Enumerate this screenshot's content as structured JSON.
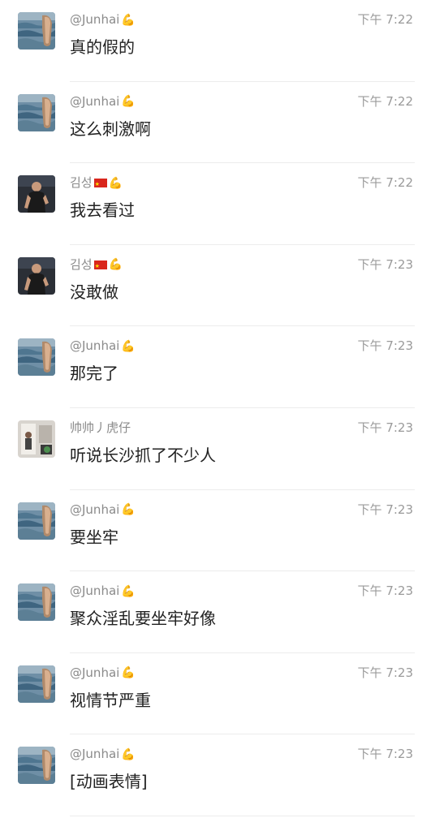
{
  "messages": [
    {
      "sender": "@Junhai",
      "badge": "💪",
      "flag": false,
      "avatar": "sea-avatar",
      "time": "下午 7:22",
      "text": "真的假的"
    },
    {
      "sender": "@Junhai",
      "badge": "💪",
      "flag": false,
      "avatar": "sea-avatar",
      "time": "下午 7:22",
      "text": "这么刺激啊"
    },
    {
      "sender": "김성",
      "badge": "💪",
      "flag": true,
      "avatar": "man-avatar",
      "time": "下午 7:22",
      "text": "我去看过"
    },
    {
      "sender": "김성",
      "badge": "💪",
      "flag": true,
      "avatar": "man-avatar",
      "time": "下午 7:23",
      "text": "没敢做"
    },
    {
      "sender": "@Junhai",
      "badge": "💪",
      "flag": false,
      "avatar": "sea-avatar",
      "time": "下午 7:23",
      "text": "那完了"
    },
    {
      "sender": "帅帅丿虎仔",
      "badge": "",
      "flag": false,
      "avatar": "room-avatar",
      "time": "下午 7:23",
      "text": "听说长沙抓了不少人"
    },
    {
      "sender": "@Junhai",
      "badge": "💪",
      "flag": false,
      "avatar": "sea-avatar",
      "time": "下午 7:23",
      "text": "要坐牢"
    },
    {
      "sender": "@Junhai",
      "badge": "💪",
      "flag": false,
      "avatar": "sea-avatar",
      "time": "下午 7:23",
      "text": "聚众淫乱要坐牢好像"
    },
    {
      "sender": "@Junhai",
      "badge": "💪",
      "flag": false,
      "avatar": "sea-avatar",
      "time": "下午 7:23",
      "text": "视情节严重"
    },
    {
      "sender": "@Junhai",
      "badge": "💪",
      "flag": false,
      "avatar": "sea-avatar",
      "time": "下午 7:23",
      "text": "[动画表情]"
    }
  ],
  "colors": {
    "name": "#8a8a8a",
    "time": "#9a9a9a",
    "message": "#222222",
    "divider": "#ececec"
  }
}
